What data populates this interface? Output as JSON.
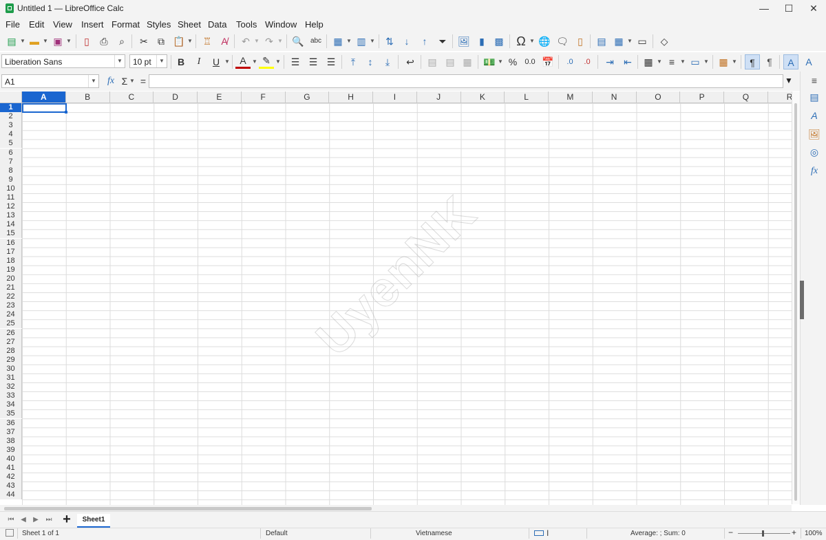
{
  "window": {
    "title": "Untitled 1 — LibreOffice Calc",
    "minimize": "—",
    "maximize": "☐",
    "close": "✕"
  },
  "menu": [
    "File",
    "Edit",
    "View",
    "Insert",
    "Format",
    "Styles",
    "Sheet",
    "Data",
    "Tools",
    "Window",
    "Help"
  ],
  "toolbar": {
    "font_name": "Liberation Sans",
    "font_size": "10 pt",
    "bold": "B",
    "italic": "I",
    "underline": "U",
    "font_color": "A",
    "percent": "%",
    "num_format": "0.0",
    "add_decimal": ".0",
    "del_decimal": ".0",
    "special_char": "Ω",
    "autosum": "Σ",
    "fx": "fx",
    "equals": "="
  },
  "namebox": {
    "value": "A1"
  },
  "formula_input": {
    "value": ""
  },
  "columns": [
    "A",
    "B",
    "C",
    "D",
    "E",
    "F",
    "G",
    "H",
    "I",
    "J",
    "K",
    "L",
    "M",
    "N",
    "O",
    "P",
    "Q",
    "R"
  ],
  "selected_column": "A",
  "rows": [
    "1",
    "2",
    "3",
    "4",
    "5",
    "6",
    "7",
    "8",
    "9",
    "10",
    "11",
    "12",
    "13",
    "14",
    "15",
    "16",
    "17",
    "18",
    "19",
    "20",
    "21",
    "22",
    "23",
    "24",
    "25",
    "26",
    "27",
    "28",
    "29",
    "30",
    "31",
    "32",
    "33",
    "34",
    "35",
    "36",
    "37",
    "38",
    "39",
    "40",
    "41",
    "42",
    "43",
    "44"
  ],
  "selected_row": "1",
  "sheet_tab": "Sheet1",
  "status": {
    "sheet": "Sheet 1 of 1",
    "page_style": "Default",
    "language": "Vietnamese",
    "sum": "Average: ; Sum: 0",
    "zoom": "100%",
    "zoom_minus": "−",
    "zoom_plus": "+"
  },
  "watermark": "UyenNK",
  "colors": {
    "accent": "#1a66d0",
    "chrome": "#f3f3f3",
    "grid": "#dcdcdc"
  }
}
